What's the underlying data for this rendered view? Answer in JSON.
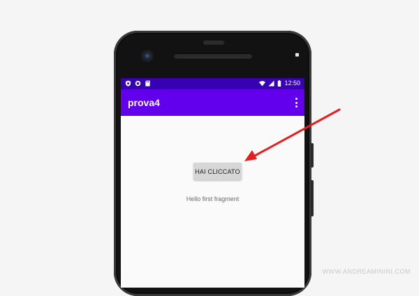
{
  "status_bar": {
    "time": "12:50",
    "left_icons": [
      "shield-icon",
      "sync-icon",
      "sd-card-icon"
    ],
    "right_icons": [
      "wifi-icon",
      "cell-signal-icon",
      "battery-icon"
    ]
  },
  "app_bar": {
    "title": "prova4",
    "overflow_icon": "more-vert-icon",
    "color": "#6200ee"
  },
  "status_bar_color": "#3700b3",
  "content": {
    "button_label": "HAI CLICCATO",
    "message": "Hello first fragment"
  },
  "annotation": {
    "arrow_color": "#e81e1e"
  },
  "watermark": "WWW.ANDREAMININI.COM"
}
